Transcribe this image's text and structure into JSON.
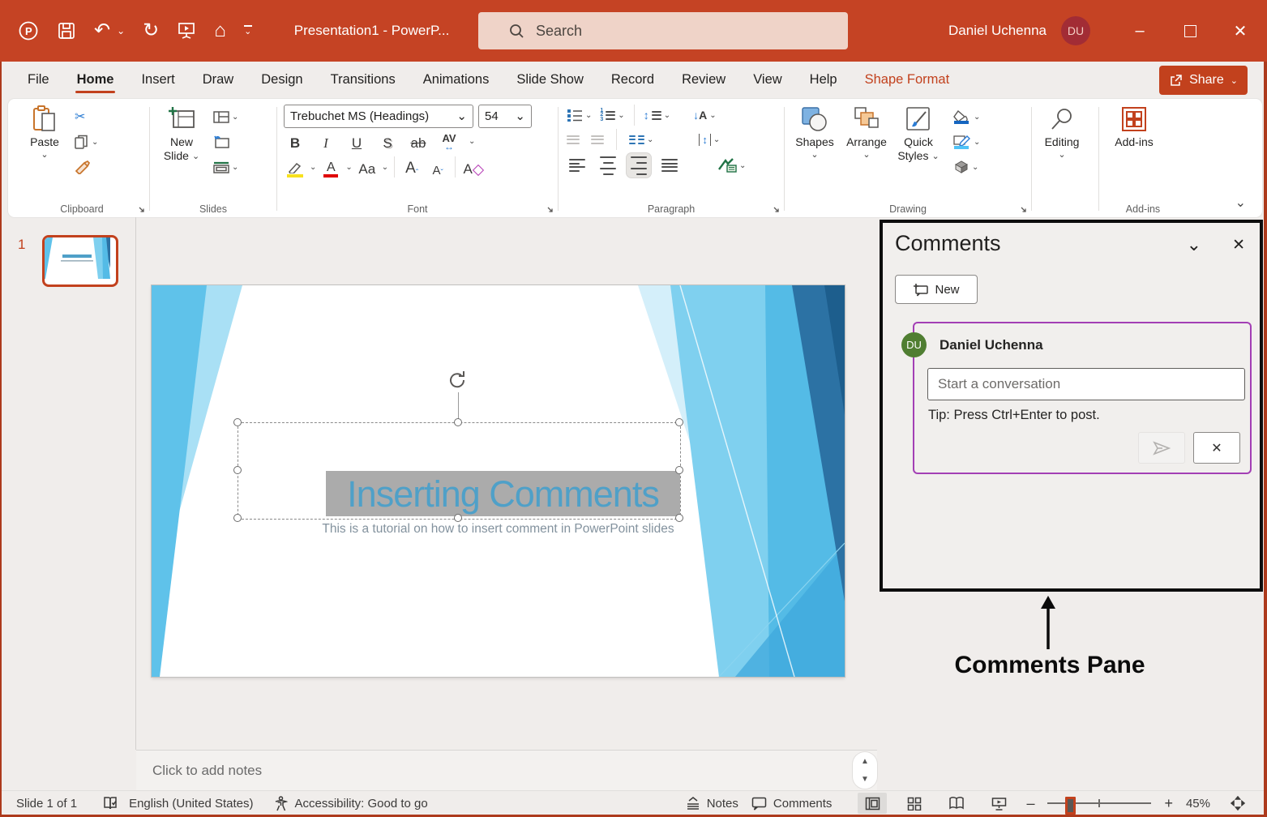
{
  "icons": {
    "chevron": "⌄",
    "undo": "↶",
    "redo": "↻",
    "home": "⌂",
    "minimize": "–",
    "close": "✕",
    "scissors": "✂",
    "up_triangle": "▲",
    "down_triangle": "▼",
    "h_arrows": "↔",
    "v_arrows": "↕",
    "down_arrow": "↓",
    "plus": "+",
    "minus": "–",
    "n1": "1",
    "n2": "2",
    "n3": "3",
    "caret_up": "ˆ",
    "caret_down": "ˇ"
  },
  "titlebar": {
    "title": "Presentation1  -  PowerP...",
    "search": "Search",
    "user_name": "Daniel Uchenna",
    "user_initials": "DU"
  },
  "menu": {
    "tabs": [
      {
        "label": "File"
      },
      {
        "label": "Home"
      },
      {
        "label": "Insert"
      },
      {
        "label": "Draw"
      },
      {
        "label": "Design"
      },
      {
        "label": "Transitions"
      },
      {
        "label": "Animations"
      },
      {
        "label": "Slide Show"
      },
      {
        "label": "Record"
      },
      {
        "label": "Review"
      },
      {
        "label": "View"
      },
      {
        "label": "Help"
      },
      {
        "label": "Shape Format"
      }
    ],
    "share": "Share"
  },
  "ribbon": {
    "clipboard": {
      "paste": "Paste",
      "label": "Clipboard"
    },
    "slides": {
      "new_line1": "New",
      "new_line2": "Slide",
      "label": "Slides"
    },
    "font": {
      "name": "Trebuchet MS (Headings)",
      "size": "54",
      "bold": "B",
      "italic": "I",
      "underline": "U",
      "shadow": "S",
      "strike": "ab",
      "spacing_a": "A",
      "spacing_v": "V",
      "case": "Aa",
      "grow": "A",
      "shrink": "A",
      "clear": "A",
      "color": "A",
      "label": "Font"
    },
    "paragraph": {
      "direction_a": "A",
      "label": "Paragraph"
    },
    "drawing": {
      "shapes": "Shapes",
      "arrange": "Arrange",
      "quick1": "Quick",
      "quick2": "Styles",
      "label": "Drawing"
    },
    "editing": {
      "button": "Editing"
    },
    "addins": {
      "button": "Add-ins",
      "label": "Add-ins"
    }
  },
  "thumbnails": {
    "slide_number": "1"
  },
  "slide": {
    "title": "Inserting Comments",
    "subtitle": "This is a tutorial on how to insert comment in PowerPoint slides"
  },
  "notes": {
    "placeholder": "Click to add notes"
  },
  "comments": {
    "title": "Comments",
    "new_button": "New",
    "author": "Daniel Uchenna",
    "initials": "DU",
    "input_placeholder": "Start a conversation",
    "tip": "Tip: Press Ctrl+Enter to post."
  },
  "annotation": {
    "label": "Comments Pane"
  },
  "statusbar": {
    "slide_indicator": "Slide 1 of 1",
    "language": "English (United States)",
    "accessibility": "Accessibility: Good to go",
    "notes": "Notes",
    "comments": "Comments",
    "zoom_level": "45%"
  },
  "colors": {
    "accent": "#C2411D",
    "titlebar": "#C54324",
    "search_bg": "#EFD3C8",
    "purple": "#A33FB5",
    "avatar_green": "#507E32",
    "avatar_maroon": "#A22C35",
    "slide_title_blue": "#4FA0C8",
    "ribbon_bg": "#FFFFFF",
    "app_bg": "#F0EDEB"
  }
}
